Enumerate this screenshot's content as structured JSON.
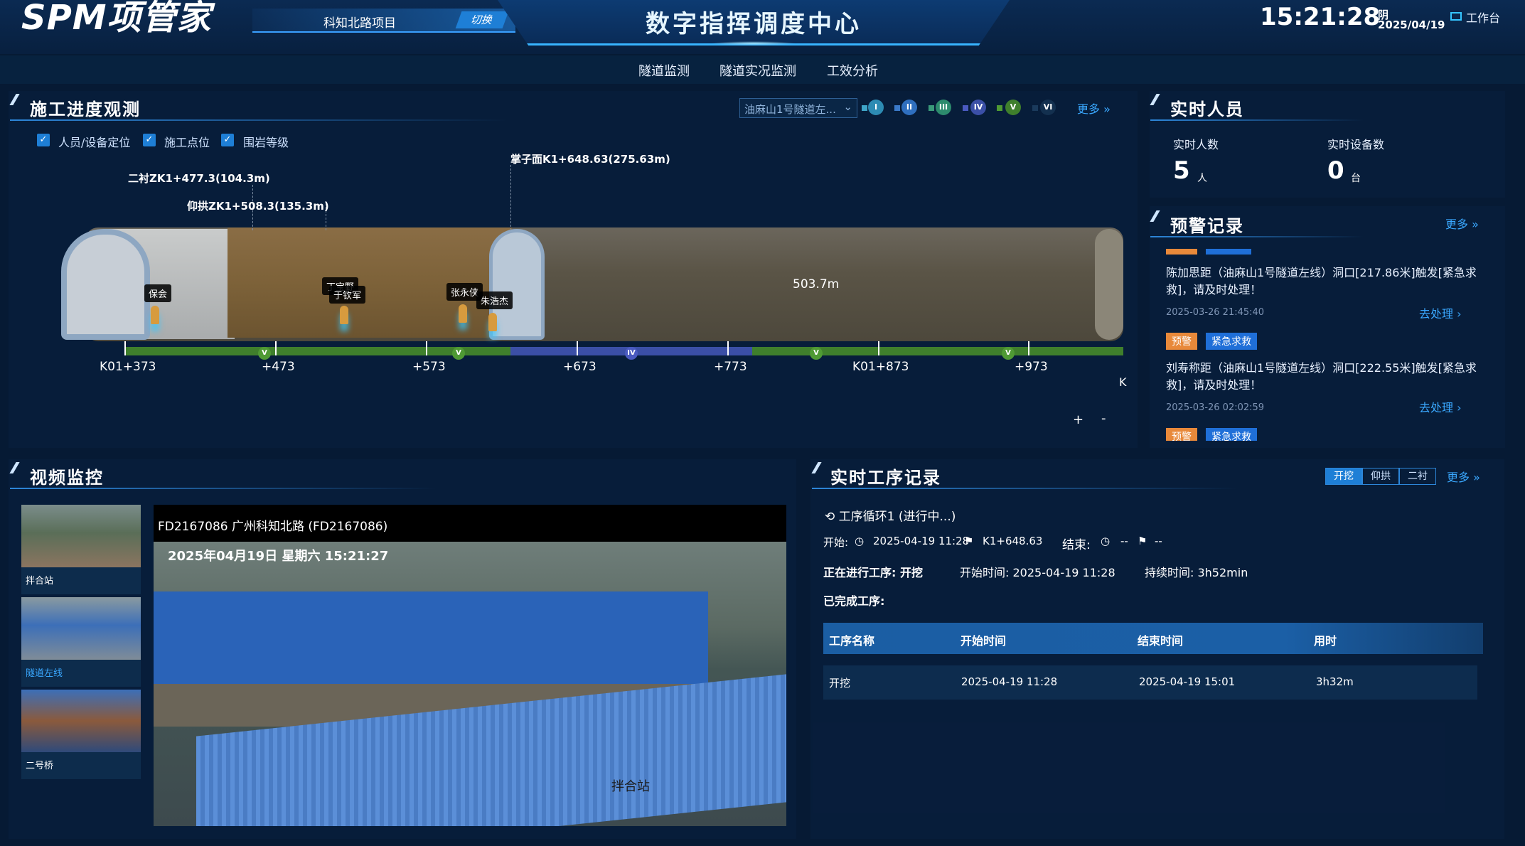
{
  "header": {
    "logo": "SPM项管家",
    "project": "科知北路项目",
    "switch_label": "切换",
    "title": "数字指挥调度中心",
    "time": "15:21:28",
    "weather": "阴",
    "date": "2025/04/19",
    "workbench": "工作台"
  },
  "nav": {
    "tabs": [
      "隧道监测",
      "隧道实况监测",
      "工效分析"
    ]
  },
  "progress": {
    "title": "施工进度观测",
    "tunnel_select": "油麻山1号隧道左...",
    "grades": [
      "I",
      "II",
      "III",
      "IV",
      "V",
      "VI"
    ],
    "more": "更多",
    "checks": [
      "人员/设备定位",
      "施工点位",
      "围岩等级"
    ],
    "markers": {
      "face": "掌子面K1+648.63(275.63m)",
      "lining": "二衬ZK1+477.3(104.3m)",
      "invert": "仰拱ZK1+508.3(135.3m)"
    },
    "length": "503.7m",
    "people": [
      "保会",
      "丁宝野",
      "于钦军",
      "张永侠",
      "朱浩杰"
    ],
    "ticks": [
      "K01+373",
      "+473",
      "+573",
      "+673",
      "+773",
      "K01+873",
      "+973"
    ],
    "scale_grades": [
      "V",
      "V",
      "IV",
      "V",
      "V"
    ],
    "k_end": "K",
    "zoom_in": "+",
    "zoom_out": "-"
  },
  "staff": {
    "title": "实时人员",
    "people_label": "实时人数",
    "people_value": "5",
    "people_unit": "人",
    "device_label": "实时设备数",
    "device_value": "0",
    "device_unit": "台"
  },
  "warnings": {
    "title": "预警记录",
    "more": "更多",
    "items": [
      {
        "text": "陈加思距（油麻山1号隧道左线）洞口[217.86米]触发[紧急求救]，请及时处理！",
        "time": "2025-03-26 21:45:40",
        "go": "去处理"
      },
      {
        "tag1": "预警",
        "tag2": "紧急求救",
        "text": "刘寿称距（油麻山1号隧道左线）洞口[222.55米]触发[紧急求救]，请及时处理！",
        "time": "2025-03-26 02:02:59",
        "go": "去处理"
      },
      {
        "tag1": "预警",
        "tag2": "紧急求救"
      }
    ]
  },
  "video": {
    "title": "视频监控",
    "thumbs": [
      "拌合站",
      "隧道左线",
      "二号桥"
    ],
    "header": "FD2167086   广州科知北路 (FD2167086)",
    "osd_time": "2025年04月19日  星期六  15:21:27",
    "osd_name": "拌合站"
  },
  "process": {
    "title": "实时工序记录",
    "segments": [
      "开挖",
      "仰拱",
      "二衬"
    ],
    "more": "更多",
    "cycle": "工序循环1 (进行中...)",
    "start_label": "开始:",
    "start_time": "2025-04-19 11:28",
    "start_pos": "K1+648.63",
    "end_label": "结束:",
    "end_time": "--",
    "end_pos": "--",
    "current_label": "正在进行工序: 开挖",
    "current_start": "开始时间: 2025-04-19 11:28",
    "current_duration": "持续时间: 3h52min",
    "done_label": "已完成工序:",
    "columns": [
      "工序名称",
      "开始时间",
      "结束时间",
      "用时"
    ],
    "rows": [
      [
        "开挖",
        "2025-04-19 11:28",
        "2025-04-19 15:01",
        "3h32m"
      ]
    ]
  },
  "colors": {
    "accent": "#3aa8ff",
    "warn_orange": "#e8893a",
    "warn_blue": "#1f6fd8",
    "grade_green": "#3f7f2c",
    "grade_blue": "#3b4fa6"
  }
}
